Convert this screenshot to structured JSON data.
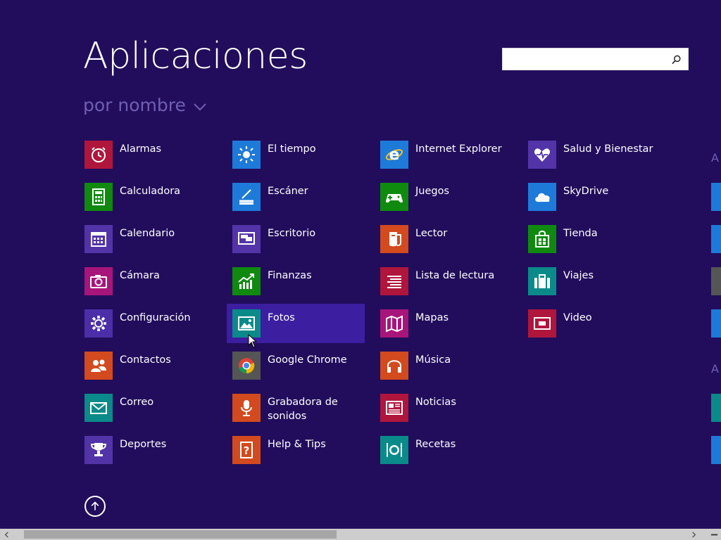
{
  "header": {
    "title": "Aplicaciones",
    "sort_label": "por nombre"
  },
  "search": {
    "value": "",
    "placeholder": ""
  },
  "colors": {
    "background": "#220d5c",
    "sort_text": "#6f5fb4",
    "hover_highlight": "#3c1ea0"
  },
  "apps": [
    {
      "label": "Alarmas",
      "icon": "alarm-clock-icon",
      "color": "#b0163c"
    },
    {
      "label": "Calculadora",
      "icon": "calculator-icon",
      "color": "#0f8a0f"
    },
    {
      "label": "Calendario",
      "icon": "calendar-icon",
      "color": "#5234a8"
    },
    {
      "label": "Cámara",
      "icon": "camera-icon",
      "color": "#a8157a"
    },
    {
      "label": "Configuración",
      "icon": "gear-icon",
      "color": "#4b2ea8"
    },
    {
      "label": "Contactos",
      "icon": "people-icon",
      "color": "#d24a1e"
    },
    {
      "label": "Correo",
      "icon": "mail-icon",
      "color": "#0b8a8a"
    },
    {
      "label": "Deportes",
      "icon": "trophy-icon",
      "color": "#5234a8"
    },
    {
      "label": "El tiempo",
      "icon": "sun-icon",
      "color": "#1e7ad8"
    },
    {
      "label": "Escáner",
      "icon": "scanner-icon",
      "color": "#1e7ad8"
    },
    {
      "label": "Escritorio",
      "icon": "desktop-icon",
      "color": "#5234a8"
    },
    {
      "label": "Finanzas",
      "icon": "chart-growth-icon",
      "color": "#0f8a0f"
    },
    {
      "label": "Fotos",
      "icon": "photo-icon",
      "color": "#0b8a8a"
    },
    {
      "label": "Google Chrome",
      "icon": "chrome-icon",
      "color": "#555555"
    },
    {
      "label": "Grabadora de\nsonidos",
      "icon": "microphone-icon",
      "color": "#d24a1e"
    },
    {
      "label": "Help & Tips",
      "icon": "help-book-icon",
      "color": "#d24a1e"
    },
    {
      "label": "Internet Explorer",
      "icon": "internet-explorer-icon",
      "color": "#1e7ad8"
    },
    {
      "label": "Juegos",
      "icon": "gamepad-icon",
      "color": "#0f8a0f"
    },
    {
      "label": "Lector",
      "icon": "reader-icon",
      "color": "#d24a1e"
    },
    {
      "label": "Lista de lectura",
      "icon": "reading-list-icon",
      "color": "#b0163c"
    },
    {
      "label": "Mapas",
      "icon": "map-icon",
      "color": "#a8157a"
    },
    {
      "label": "Música",
      "icon": "headphones-icon",
      "color": "#d24a1e"
    },
    {
      "label": "Noticias",
      "icon": "newspaper-icon",
      "color": "#b0163c"
    },
    {
      "label": "Recetas",
      "icon": "dinner-plate-icon",
      "color": "#0b8a8a"
    },
    {
      "label": "Salud y Bienestar",
      "icon": "heart-monitor-icon",
      "color": "#5234a8"
    },
    {
      "label": "SkyDrive",
      "icon": "cloud-icon",
      "color": "#1e7ad8"
    },
    {
      "label": "Tienda",
      "icon": "store-bag-icon",
      "color": "#0f8a0f"
    },
    {
      "label": "Viajes",
      "icon": "suitcase-icon",
      "color": "#0b8a8a"
    },
    {
      "label": "Video",
      "icon": "video-icon",
      "color": "#b0163c"
    }
  ],
  "partial_column": {
    "section_letter": "A",
    "tile_colors": [
      "#1e7ad8",
      "#1e7ad8",
      "#555555",
      "#1e7ad8",
      "#0b8a8a",
      "#1e7ad8"
    ]
  }
}
